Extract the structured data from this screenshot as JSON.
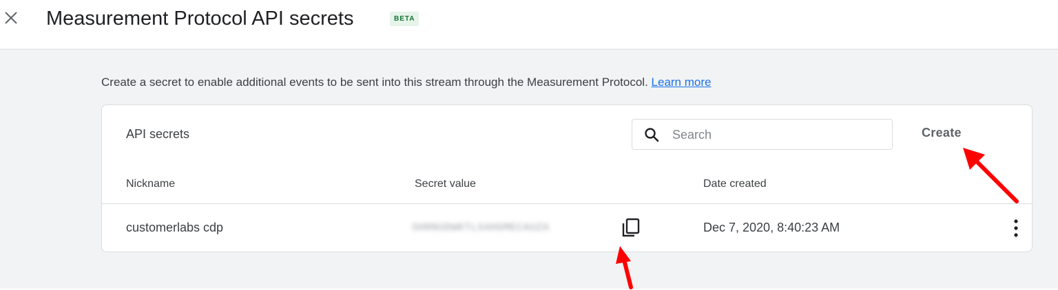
{
  "dialog": {
    "title": "Measurement Protocol API secrets",
    "badge": "BETA",
    "close_icon": "close-icon"
  },
  "intro": {
    "text": "Create a secret to enable additional events to be sent into this stream through the Measurement Protocol.",
    "link": "Learn more"
  },
  "card": {
    "title": "API secrets",
    "search": {
      "placeholder": "Search",
      "value": "",
      "icon": "search-icon"
    },
    "create_label": "Create",
    "columns": [
      "Nickname",
      "Secret value",
      "Date created"
    ],
    "rows": [
      {
        "nickname": "customerlabs cdp",
        "secret_value": "SHRNUDWKTLXAHGMECAUZA",
        "date_created": "Dec 7, 2020, 8:40:23 AM",
        "copy_icon": "copy-icon",
        "menu_icon": "more-vert-icon"
      }
    ]
  },
  "colors": {
    "accent": "#1a73e8",
    "beta_bg": "#e6f4ea",
    "beta_text": "#137333",
    "annotation_arrow": "#ff0000",
    "content_bg": "#f1f3f4"
  }
}
